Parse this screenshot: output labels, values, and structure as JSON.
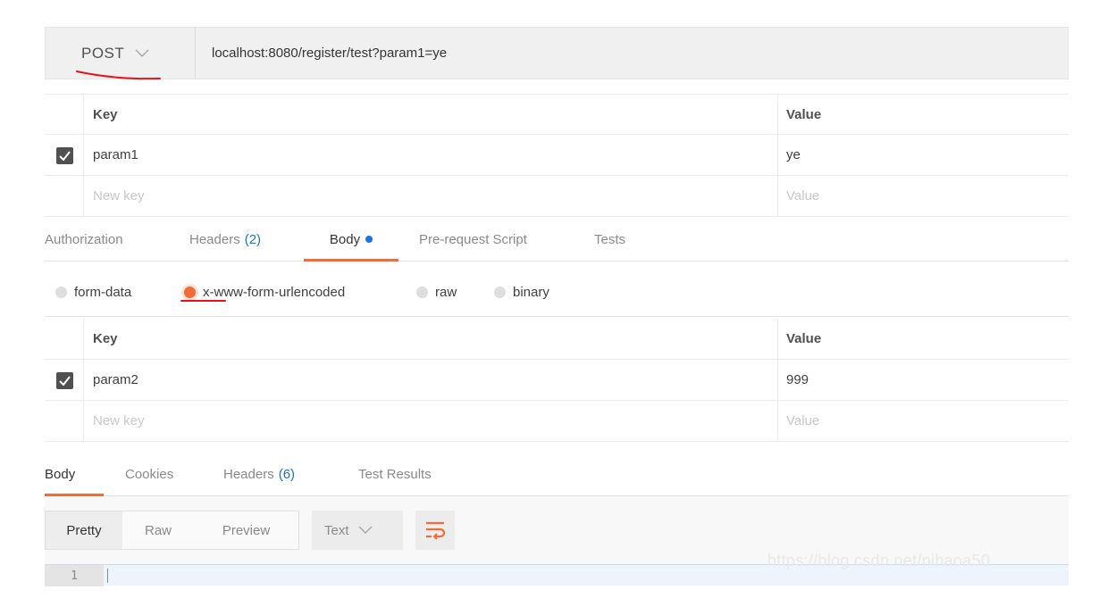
{
  "request": {
    "method": "POST",
    "url": "localhost:8080/register/test?param1=ye"
  },
  "params": {
    "header_key": "Key",
    "header_value": "Value",
    "rows": [
      {
        "key": "param1",
        "value": "ye",
        "checked": true
      }
    ],
    "new_key_placeholder": "New key",
    "new_value_placeholder": "Value"
  },
  "request_tabs": {
    "authorization": "Authorization",
    "headers": "Headers",
    "headers_count": "(2)",
    "body": "Body",
    "prerequest": "Pre-request Script",
    "tests": "Tests",
    "active": "Body"
  },
  "body_modes": {
    "form_data": "form-data",
    "urlencoded": "x-www-form-urlencoded",
    "raw": "raw",
    "binary": "binary",
    "selected": "x-www-form-urlencoded"
  },
  "body_params": {
    "header_key": "Key",
    "header_value": "Value",
    "rows": [
      {
        "key": "param2",
        "value": "999",
        "checked": true
      }
    ],
    "new_key_placeholder": "New key",
    "new_value_placeholder": "Value"
  },
  "response_tabs": {
    "body": "Body",
    "cookies": "Cookies",
    "headers": "Headers",
    "headers_count": "(6)",
    "test_results": "Test Results",
    "active": "Body"
  },
  "response_toolbar": {
    "pretty": "Pretty",
    "raw": "Raw",
    "preview": "Preview",
    "format": "Text",
    "active": "Pretty"
  },
  "editor": {
    "line_number": "1"
  },
  "watermark": "https://blog.csdn.net/nihaoa50",
  "colors": {
    "accent": "#f26b3a",
    "count_blue": "#1a73c8",
    "annotation_red": "#e8101a"
  },
  "icons": {
    "method_dropdown": "chevron-down-icon",
    "checkbox": "check-icon",
    "wrap": "wrap-lines-icon"
  }
}
